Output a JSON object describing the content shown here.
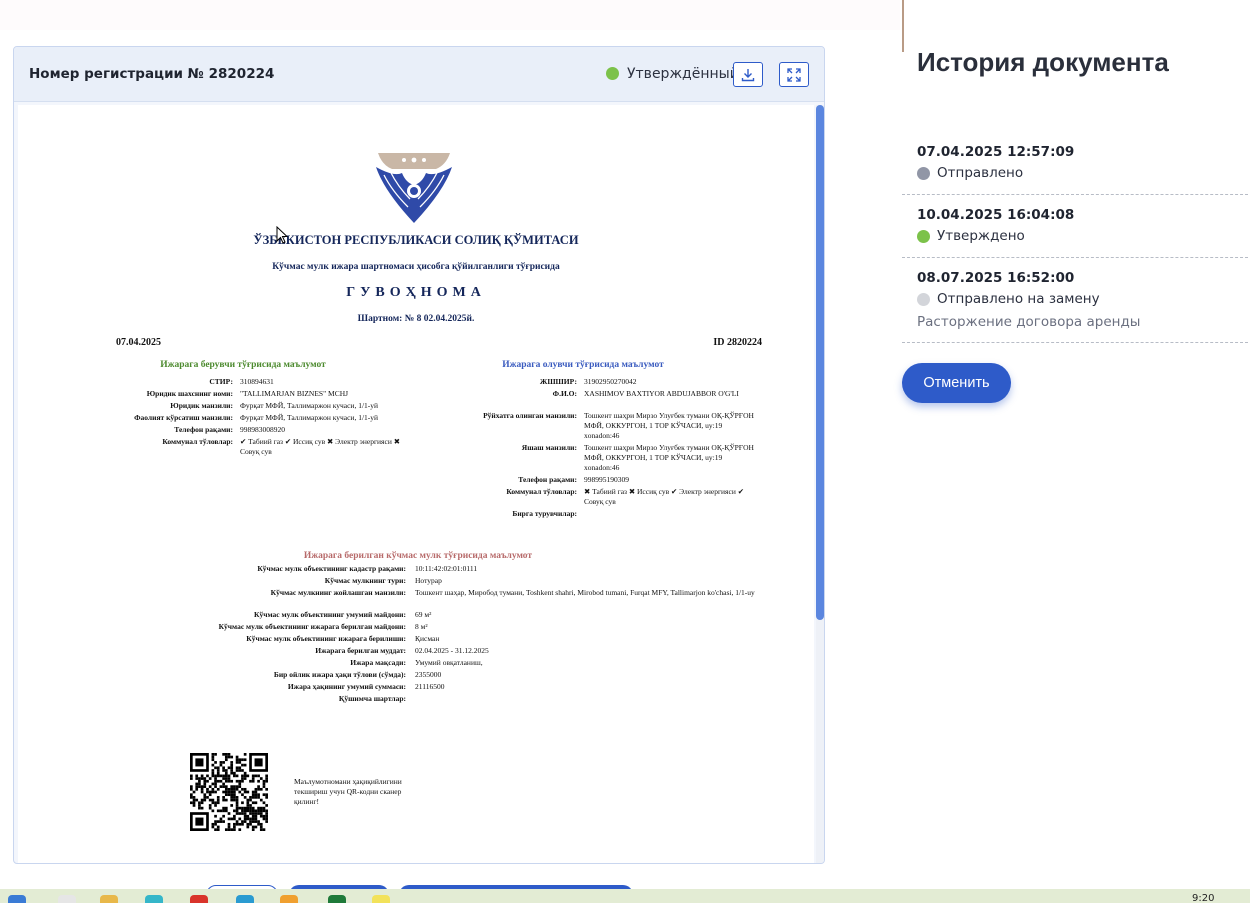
{
  "viewer": {
    "reg_label": "Номер регистрации № 2820224",
    "status": "Утверждённый",
    "icons": {
      "download": "download-icon",
      "expand": "expand-icon"
    },
    "status_color": "#7cc24a"
  },
  "certificate": {
    "org": "ЎЗБЕКИСТОН РЕСПУБЛИКАСИ СОЛИҚ ҚЎМИТАСИ",
    "subtitle": "Кўчмас мулк ижара шартномаси ҳисобга қўйилганлиги тўғрисида",
    "doc_title": "ГУВОҲНОМА",
    "contract": "Шартном: № 8 02.04.2025й.",
    "date": "07.04.2025",
    "id": "ID 2820224",
    "lessor": {
      "heading": "Ижарага берувчи тўғрисида маълумот",
      "fields": [
        {
          "k": "СТИР:",
          "v": "310894631"
        },
        {
          "k": "Юридик шахснинг номи:",
          "v": "\"TALLIMARJAN BIZNES\" MCHJ"
        },
        {
          "k": "Юридик манзили:",
          "v": "Фурқат МФЙ, Таллимаржон кучаси, 1/1-уй"
        },
        {
          "k": "Фаолият кўрсатиш манзили:",
          "v": "Фурқат МФЙ, Таллимаржон кучаси, 1/1-уй"
        },
        {
          "k": "Телефон рақами:",
          "v": "998983008920"
        },
        {
          "k": "Коммунал тўловлар:",
          "v": "✔ Табиий газ ✔ Иссиқ сув ✖ Электр энергияси ✖ Совуқ сув"
        }
      ]
    },
    "lessee": {
      "heading": "Ижарага олувчи тўғрисида маълумот",
      "fields": [
        {
          "k": "ЖШШИР:",
          "v": "31902950270042"
        },
        {
          "k": "Ф.И.О:",
          "v": "XASHIMOV BAXTIYOR ABDUJABBOR O'G'LI"
        },
        {
          "k": "Рўйхатга олинган манзили:",
          "v": "Тошкент шаҳри Мирзо Улуғбек тумани ОҚ-ҚЎРҒОН МФЙ, ОККУРГОН, 1 ТОР КЎЧАСИ, uy:19 xonadon:46"
        },
        {
          "k": "Яшаш манзили:",
          "v": "Тошкент шаҳри Мирзо Улуғбек тумани ОҚ-ҚЎРҒОН МФЙ, ОККУРГОН, 1 ТОР КЎЧАСИ, uy:19 xonadon:46"
        },
        {
          "k": "Телефон рақами:",
          "v": "998995190309"
        },
        {
          "k": "Коммунал тўловлар:",
          "v": "✖ Табиий газ ✖ Иссиқ сув ✔ Электр энергияси ✔ Совуқ сув"
        },
        {
          "k": "Бирга турувчилар:",
          "v": ""
        }
      ]
    },
    "property": {
      "heading": "Ижарага берилган кўчмас мулк тўғрисида маълумот",
      "fields": [
        {
          "k": "Кўчмас мулк объектининг кадастр рақами:",
          "v": "10:11:42:02:01:0111"
        },
        {
          "k": "Кўчмас мулкнинг тури:",
          "v": "Нотурар"
        },
        {
          "k": "Кўчмас мулкнинг жойлашган манзили:",
          "v": "Тошкент шаҳар, Миробод тумани, Toshkent shahri, Mirobod tumani, Furqat MFY, Tallimarjon ko'chasi, 1/1-uy"
        },
        {
          "k": "Кўчмас мулк объектининг умумий майдони:",
          "v": "69 м²"
        },
        {
          "k": "Кўчмас мулк объектининг ижарага берилган майдони:",
          "v": "8 м²"
        },
        {
          "k": "Кўчмас мулк объектининг ижарага берилиши:",
          "v": "Қисман"
        },
        {
          "k": "Ижарага берилган муддат:",
          "v": "02.04.2025 - 31.12.2025"
        },
        {
          "k": "Ижара мақсади:",
          "v": "Умумий овқатланиш,"
        },
        {
          "k": "Бир ойлик ижара ҳақи тўлови (сўмда):",
          "v": "2355000"
        },
        {
          "k": "Ижара ҳақининг умумий суммаси:",
          "v": "21116500"
        },
        {
          "k": "Қўшимча шартлар:",
          "v": ""
        }
      ]
    },
    "qr_caption": "Маълумотномани ҳақиқийлигини текшириш учун QR-кодни сканер қилинг!",
    "colors": {
      "navy": "#14265a",
      "lessor": "#4c8a2e",
      "lessee": "#3a5bbf",
      "property": "#b76a6a"
    }
  },
  "history": {
    "title": "История документа",
    "items": [
      {
        "date": "07.04.2025 12:57:09",
        "status": "Отправлено",
        "color": "#9196a6",
        "note": ""
      },
      {
        "date": "10.04.2025 16:04:08",
        "status": "Утверждено",
        "color": "#7cc24a",
        "note": ""
      },
      {
        "date": "08.07.2025 16:52:00",
        "status": "Отправлено на замену",
        "color": "#d3d5da",
        "note": "Расторжение договора аренды"
      }
    ],
    "cancel_label": "Отменить",
    "accent": "#2e5bc9"
  },
  "taskbar": {
    "clock": "9:20"
  }
}
